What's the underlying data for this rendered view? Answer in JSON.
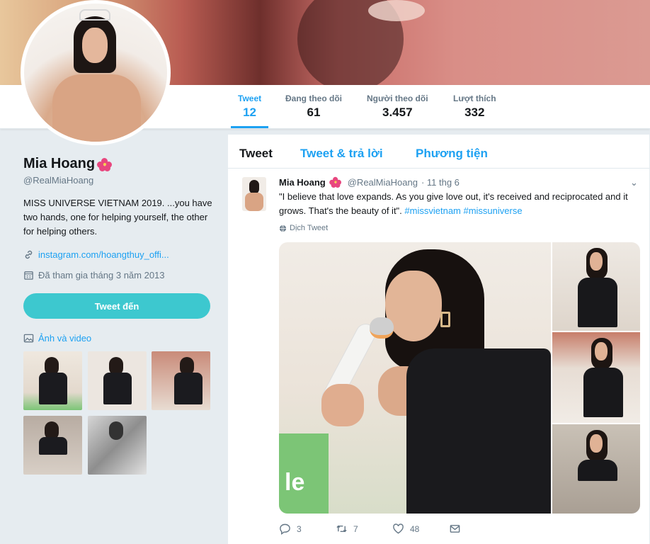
{
  "profile": {
    "name": "Mia Hoang",
    "handle": "@RealMiaHoang",
    "bio": "MISS UNIVERSE VIETNAM 2019. ...you have two hands, one for helping yourself, the other for helping others.",
    "link": "instagram.com/hoangthuy_offi...",
    "joined": "Đã tham gia tháng 3 năm 2013",
    "tweet_to_button": "Tweet đến",
    "media_title": "Ảnh và video"
  },
  "stats": [
    {
      "label": "Tweet",
      "value": "12"
    },
    {
      "label": "Đang theo dõi",
      "value": "61"
    },
    {
      "label": "Người theo dõi",
      "value": "3.457"
    },
    {
      "label": "Lượt thích",
      "value": "332"
    }
  ],
  "tabs": [
    "Tweet",
    "Tweet & trả lời",
    "Phương tiện"
  ],
  "tweet": {
    "name": "Mia Hoang",
    "handle": "@RealMiaHoang",
    "date": "· 11 thg 6",
    "text": "\"I believe that love expands. As you give love out, it's received and reciprocated and it grows. That's the beauty of it\".",
    "hashtags": "#missvietnam #missuniverse",
    "translate": "Dịch Tweet",
    "image_text": "le",
    "replies": "3",
    "retweets": "7",
    "likes": "48"
  },
  "colors": {
    "accent": "#1da1f2",
    "button": "#3dc8cf",
    "background": "#e6ecf0"
  },
  "icons": [
    "link-icon",
    "calendar-icon",
    "image-icon",
    "globe-icon",
    "reply-icon",
    "retweet-icon",
    "heart-icon",
    "message-icon",
    "chevron-down-icon",
    "hibiscus-icon"
  ]
}
